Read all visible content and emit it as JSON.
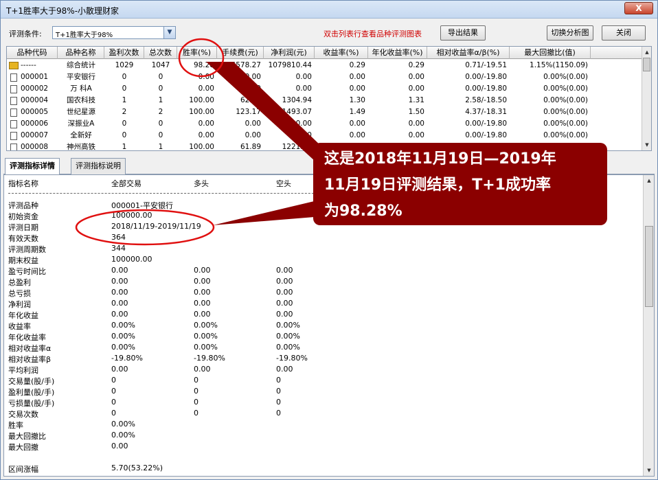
{
  "window": {
    "title": "T+1胜率大于98%-小散理财家",
    "close_glyph": "X"
  },
  "toolbar": {
    "condition_label": "评测条件:",
    "condition_value": "T+1胜率大于98%",
    "hint": "双击列表行查看品种评测图表",
    "export_label": "导出结果",
    "switch_label": "切换分析图",
    "close_label": "关闭"
  },
  "grid": {
    "columns": [
      "品种代码",
      "品种名称",
      "盈利次数",
      "总次数",
      "胜率(%)",
      "手续费(元)",
      "净利润(元)",
      "收益率(%)",
      "年化收益率(%)",
      "相对收益率α/β(%)",
      "最大回撤比(值)"
    ],
    "rows": [
      {
        "code": "------",
        "name": "综合统计",
        "win": "1029",
        "total": "1047",
        "rate": "98.28",
        "fee": "64578.27",
        "profit": "1079810.44",
        "ret": "0.29",
        "annual": "0.29",
        "rel": "0.71/-19.51",
        "dd": "1.15%(1150.09)",
        "icon": "folder"
      },
      {
        "code": "000001",
        "name": "平安银行",
        "win": "0",
        "total": "0",
        "rate": "0.00",
        "fee": "0.00",
        "profit": "0.00",
        "ret": "0.00",
        "annual": "0.00",
        "rel": "0.00/-19.80",
        "dd": "0.00%(0.00)",
        "icon": "doc"
      },
      {
        "code": "000002",
        "name": "万 科A",
        "win": "0",
        "total": "0",
        "rate": "0.00",
        "fee": "0.00",
        "profit": "0.00",
        "ret": "0.00",
        "annual": "0.00",
        "rel": "0.00/-19.80",
        "dd": "0.00%(0.00)",
        "icon": "doc"
      },
      {
        "code": "000004",
        "name": "国农科技",
        "win": "1",
        "total": "1",
        "rate": "100.00",
        "fee": "62.00",
        "profit": "1304.94",
        "ret": "1.30",
        "annual": "1.31",
        "rel": "2.58/-18.50",
        "dd": "0.00%(0.00)",
        "icon": "doc"
      },
      {
        "code": "000005",
        "name": "世纪星源",
        "win": "2",
        "total": "2",
        "rate": "100.00",
        "fee": "123.17",
        "profit": "1493.07",
        "ret": "1.49",
        "annual": "1.50",
        "rel": "4.37/-18.31",
        "dd": "0.00%(0.00)",
        "icon": "doc"
      },
      {
        "code": "000006",
        "name": "深振业A",
        "win": "0",
        "total": "0",
        "rate": "0.00",
        "fee": "0.00",
        "profit": "0.00",
        "ret": "0.00",
        "annual": "0.00",
        "rel": "0.00/-19.80",
        "dd": "0.00%(0.00)",
        "icon": "doc"
      },
      {
        "code": "000007",
        "name": "全新好",
        "win": "0",
        "total": "0",
        "rate": "0.00",
        "fee": "0.00",
        "profit": "0.00",
        "ret": "0.00",
        "annual": "0.00",
        "rel": "0.00/-19.80",
        "dd": "0.00%(0.00)",
        "icon": "doc"
      },
      {
        "code": "000008",
        "name": "神州高铁",
        "win": "1",
        "total": "1",
        "rate": "100.00",
        "fee": "61.89",
        "profit": "1221.18",
        "ret": "1.22",
        "annual": "1.23",
        "rel": "",
        "dd": "",
        "icon": "doc"
      }
    ]
  },
  "tabs": {
    "detail": "评测指标详情",
    "explain": "评测指标说明"
  },
  "detail": {
    "headers": [
      "指标名称",
      "全部交易",
      "多头",
      "空头"
    ],
    "lines": [
      {
        "name": "评测品种",
        "v1": "000001-平安银行",
        "v2": "",
        "v3": ""
      },
      {
        "name": "初始资金",
        "v1": "100000.00",
        "v2": "",
        "v3": ""
      },
      {
        "name": "评测日期",
        "v1": "2018/11/19-2019/11/19",
        "v2": "",
        "v3": ""
      },
      {
        "name": "有效天数",
        "v1": "364",
        "v2": "",
        "v3": ""
      },
      {
        "name": "评测周期数",
        "v1": "344",
        "v2": "",
        "v3": ""
      },
      {
        "name": "期末权益",
        "v1": "100000.00",
        "v2": "",
        "v3": ""
      },
      {
        "name": "盈亏时间比",
        "v1": "0.00",
        "v2": "0.00",
        "v3": "0.00"
      },
      {
        "name": "总盈利",
        "v1": "0.00",
        "v2": "0.00",
        "v3": "0.00"
      },
      {
        "name": "总亏损",
        "v1": "0.00",
        "v2": "0.00",
        "v3": "0.00"
      },
      {
        "name": "净利润",
        "v1": "0.00",
        "v2": "0.00",
        "v3": "0.00"
      },
      {
        "name": "年化收益",
        "v1": "0.00",
        "v2": "0.00",
        "v3": "0.00"
      },
      {
        "name": "收益率",
        "v1": "0.00%",
        "v2": "0.00%",
        "v3": "0.00%"
      },
      {
        "name": "年化收益率",
        "v1": "0.00%",
        "v2": "0.00%",
        "v3": "0.00%"
      },
      {
        "name": "相对收益率α",
        "v1": "0.00%",
        "v2": "0.00%",
        "v3": "0.00%"
      },
      {
        "name": "相对收益率β",
        "v1": "-19.80%",
        "v2": "-19.80%",
        "v3": "-19.80%"
      },
      {
        "name": "平均利润",
        "v1": "0.00",
        "v2": "0.00",
        "v3": "0.00"
      },
      {
        "name": "交易量(股/手)",
        "v1": "0",
        "v2": "0",
        "v3": "0"
      },
      {
        "name": "盈利量(股/手)",
        "v1": "0",
        "v2": "0",
        "v3": "0"
      },
      {
        "name": "亏损量(股/手)",
        "v1": "0",
        "v2": "0",
        "v3": "0"
      },
      {
        "name": "交易次数",
        "v1": "0",
        "v2": "0",
        "v3": "0"
      },
      {
        "name": "胜率",
        "v1": "0.00%",
        "v2": "",
        "v3": ""
      },
      {
        "name": "最大回撤比",
        "v1": "0.00%",
        "v2": "",
        "v3": ""
      },
      {
        "name": "最大回撤",
        "v1": "0.00",
        "v2": "",
        "v3": ""
      },
      {
        "name": "",
        "v1": "",
        "v2": "",
        "v3": ""
      },
      {
        "name": "区间涨幅",
        "v1": "5.70(53.22%)",
        "v2": "",
        "v3": ""
      }
    ]
  },
  "annotation": {
    "line1": "这是2018年11月19日—2019年",
    "line2": "11月19日评测结果，T+1成功率",
    "line3": "为98.28%"
  },
  "colors": {
    "callout": "#8b0000",
    "circle": "#e01010",
    "hint": "#d00000"
  }
}
